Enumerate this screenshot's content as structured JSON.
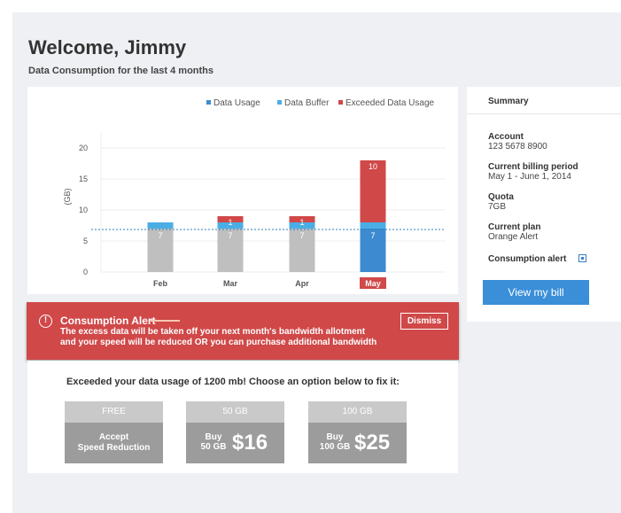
{
  "header": {
    "title": "Welcome, Jimmy",
    "subtitle": "Data Consumption for the last 4 months"
  },
  "chart_data": {
    "type": "bar",
    "stacked": true,
    "categories": [
      "Feb",
      "Mar",
      "Apr",
      "May"
    ],
    "series": [
      {
        "name": "Data Usage",
        "color": "#bfbfbf",
        "values": [
          7,
          7,
          7,
          7
        ]
      },
      {
        "name": "Data Buffer",
        "color": "#4aaee5",
        "values": [
          1,
          1,
          1,
          1
        ]
      },
      {
        "name": "Exceeded Data Usage",
        "color": "#d04848",
        "values": [
          0,
          1,
          1,
          10
        ]
      }
    ],
    "data_labels": {
      "Data Usage": [
        "7",
        "7",
        "7",
        "7"
      ],
      "Exceeded Data Usage": [
        "",
        "1",
        "1",
        "10"
      ]
    },
    "highlight_category": "May",
    "highlight_color": "#d04848",
    "highlight_usage_color": "#3d8ad0",
    "ylabel": "(GB)",
    "yticks": [
      0,
      5,
      10,
      15,
      20
    ],
    "ylim": [
      0,
      23
    ],
    "quota_line": 7,
    "grid": true,
    "legend_position": "top-right"
  },
  "summary": {
    "heading": "Summary",
    "account_label": "Account",
    "account_value": "123 5678 8900",
    "billing_label": "Current billing period",
    "billing_value": "May 1 - June 1, 2014",
    "quota_label": "Quota",
    "quota_value": "7GB",
    "plan_label": "Current plan",
    "plan_value": "Orange Alert",
    "alert_label": "Consumption alert",
    "alert_checked": true,
    "bill_button": "View my bill"
  },
  "alert": {
    "icon": "exclamation-circle-icon",
    "icon_glyph": "!",
    "title": "Consumption Alert",
    "line1": "The excess data will be taken off your next month's bandwidth allotment",
    "line2": "and your speed will be reduced OR you can purchase additional bandwidth",
    "dismiss": "Dismiss",
    "color": "#d04848"
  },
  "options": {
    "title": "Exceeded your data usage of 1200 mb! Choose an option below to fix it:",
    "free": {
      "top": "FREE",
      "line1": "Accept",
      "line2": "Speed Reduction"
    },
    "opt50": {
      "top": "50 GB",
      "buy": "Buy",
      "size": "50 GB",
      "price": "$16"
    },
    "opt100": {
      "top": "100 GB",
      "buy": "Buy",
      "size": "100 GB",
      "price": "$25"
    }
  }
}
